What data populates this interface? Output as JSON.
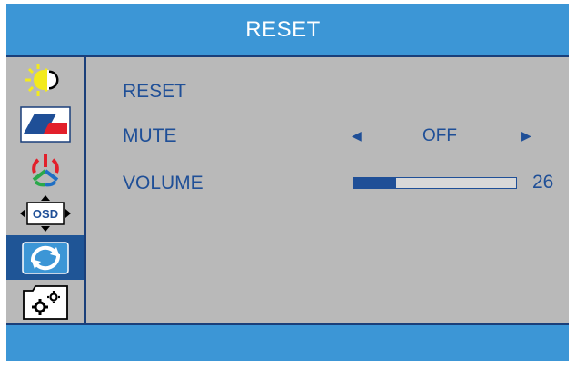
{
  "header": {
    "title": "RESET"
  },
  "sidebar": {
    "items": [
      {
        "icon": "brightness-icon",
        "name": "sidebar-item-brightness"
      },
      {
        "icon": "image-icon",
        "name": "sidebar-item-image"
      },
      {
        "icon": "color-icon",
        "name": "sidebar-item-color"
      },
      {
        "icon": "osd-icon",
        "name": "sidebar-item-osd",
        "text": "OSD"
      },
      {
        "icon": "reset-icon",
        "name": "sidebar-item-reset",
        "active": true
      },
      {
        "icon": "settings-icon",
        "name": "sidebar-item-settings"
      }
    ]
  },
  "menu": {
    "reset_label": "RESET",
    "mute_label": "MUTE",
    "mute_value": "OFF",
    "volume_label": "VOLUME",
    "volume_value": "26",
    "volume_level": 0.26
  },
  "colors": {
    "header_blue": "#3c96d6",
    "text_blue": "#1f4f97",
    "panel_gray": "#b9b9b9",
    "active_blue": "#1f5596"
  }
}
